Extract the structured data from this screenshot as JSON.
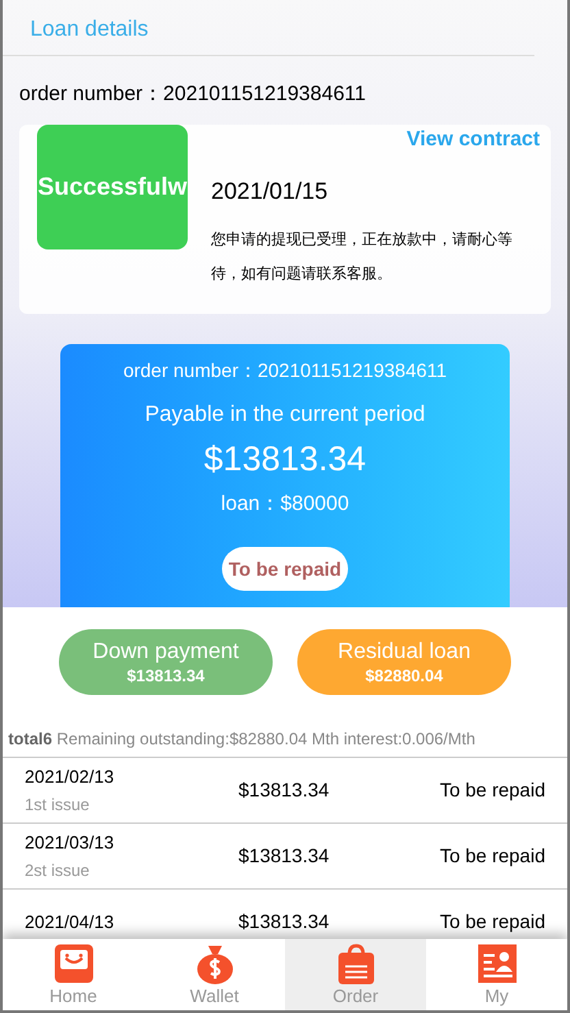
{
  "header": {
    "title": "Loan details"
  },
  "order_number": "order number：202101151219384611",
  "status_card": {
    "badge": "Successfulw",
    "link": "View contract",
    "date": "2021/01/15",
    "message": "您申请的提现已受理，正在放款中，请耐心等待，如有问题请联系客服。"
  },
  "payment_card": {
    "order_number": "order number：202101151219384611",
    "label": "Payable in the current period",
    "amount": "$13813.34",
    "loan": "loan：$80000",
    "status_button": "To be repaid"
  },
  "buttons": [
    {
      "label": "Down payment",
      "amount": "$13813.34",
      "kind": "green"
    },
    {
      "label": "Residual loan",
      "amount": "$82880.04",
      "kind": "orange"
    }
  ],
  "summary": {
    "total": "total6",
    "details": "Remaining outstanding:$82880.04 Mth interest:0.006/Mth"
  },
  "schedule": [
    {
      "date": "2021/02/13",
      "issue": "1st issue",
      "amount": "$13813.34",
      "status": "To be repaid"
    },
    {
      "date": "2021/03/13",
      "issue": "2st issue",
      "amount": "$13813.34",
      "status": "To be repaid"
    },
    {
      "date": "2021/04/13",
      "amount": "$13813.34",
      "status": "To be repaid"
    }
  ],
  "tab_bar": [
    {
      "label": "Home",
      "kind": "home",
      "selected": false
    },
    {
      "label": "Wallet",
      "kind": "wallet",
      "selected": false
    },
    {
      "label": "Order",
      "kind": "order",
      "selected": true
    },
    {
      "label": "My",
      "kind": "my",
      "selected": false
    }
  ]
}
